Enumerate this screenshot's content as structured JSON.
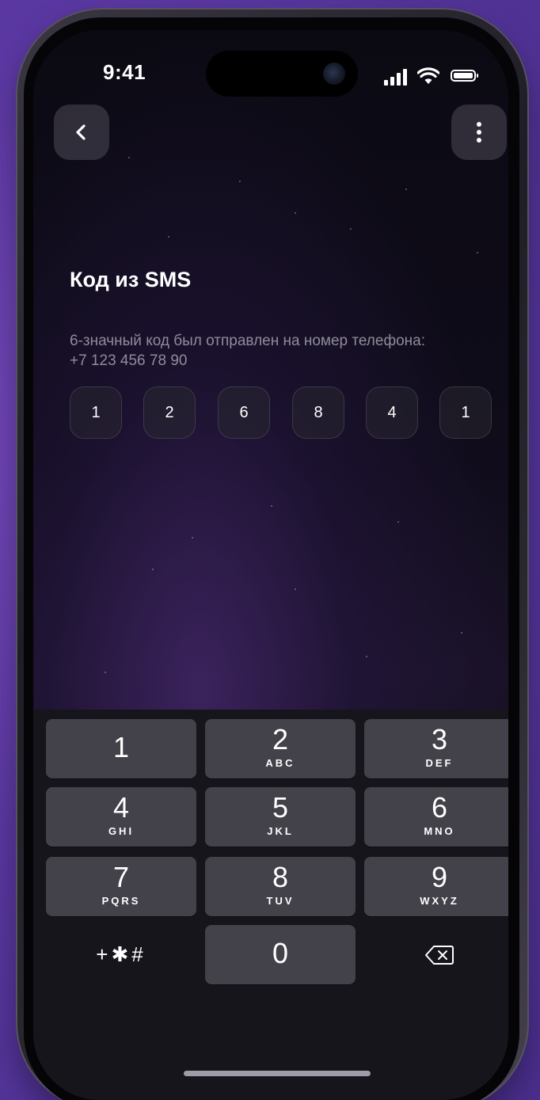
{
  "status_bar": {
    "time": "9:41"
  },
  "header": {
    "back_icon": "chevron-left-icon",
    "more_icon": "more-vertical-icon"
  },
  "main": {
    "title": "Код из SMS",
    "subtitle": "6-значный код  был отправлен на номер телефона: +7 123 456 78 90",
    "code_digits": [
      "1",
      "2",
      "6",
      "8",
      "4",
      "1"
    ]
  },
  "keypad": {
    "keys": [
      {
        "digit": "1",
        "letters": ""
      },
      {
        "digit": "2",
        "letters": "ABC"
      },
      {
        "digit": "3",
        "letters": "DEF"
      },
      {
        "digit": "4",
        "letters": "GHI"
      },
      {
        "digit": "5",
        "letters": "JKL"
      },
      {
        "digit": "6",
        "letters": "MNO"
      },
      {
        "digit": "7",
        "letters": "PQRS"
      },
      {
        "digit": "8",
        "letters": "TUV"
      },
      {
        "digit": "9",
        "letters": "WXYZ"
      },
      {
        "digit": "0",
        "letters": ""
      }
    ],
    "symbols_label": "+✱#",
    "delete_icon": "backspace-icon"
  },
  "colors": {
    "background": "#5b38a3",
    "key_background": "#434149",
    "keypad_background": "#17151c",
    "subtitle_text": "#8f8c99"
  }
}
